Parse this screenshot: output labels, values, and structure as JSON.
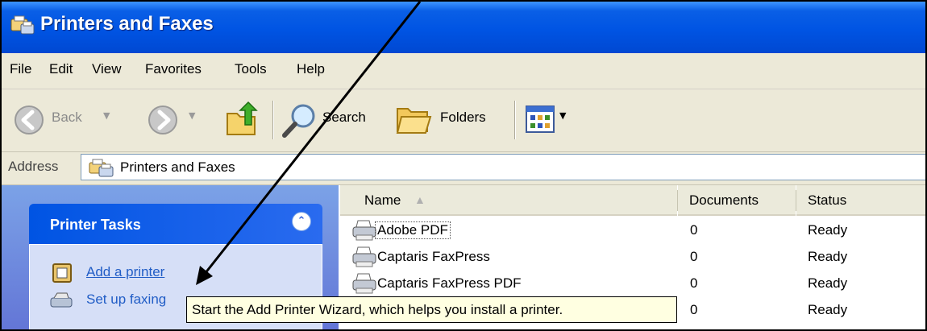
{
  "window": {
    "title": "Printers and Faxes"
  },
  "menu": [
    "File",
    "Edit",
    "View",
    "Favorites",
    "Tools",
    "Help"
  ],
  "toolbar": {
    "back": "Back",
    "search": "Search",
    "folders": "Folders"
  },
  "address": {
    "label": "Address",
    "value": "Printers and Faxes"
  },
  "task_pane": {
    "title": "Printer Tasks",
    "links": [
      "Add a printer",
      "Set up faxing"
    ]
  },
  "list": {
    "columns": [
      "Name",
      "Documents",
      "Status"
    ],
    "rows": [
      {
        "name": "Adobe PDF",
        "documents": "0",
        "status": "Ready"
      },
      {
        "name": "Captaris FaxPress",
        "documents": "0",
        "status": "Ready"
      },
      {
        "name": "Captaris FaxPress PDF",
        "documents": "0",
        "status": "Ready"
      },
      {
        "name": "",
        "documents": "0",
        "status": "Ready"
      }
    ]
  },
  "tooltip": {
    "text": "Start the Add Printer Wizard, which helps you install a printer."
  },
  "colors": {
    "titlebar": "#0054e3",
    "task_header": "#0054e3",
    "task_body": "#d6dff7",
    "link": "#215dc6",
    "tooltip_bg": "#ffffe1"
  }
}
